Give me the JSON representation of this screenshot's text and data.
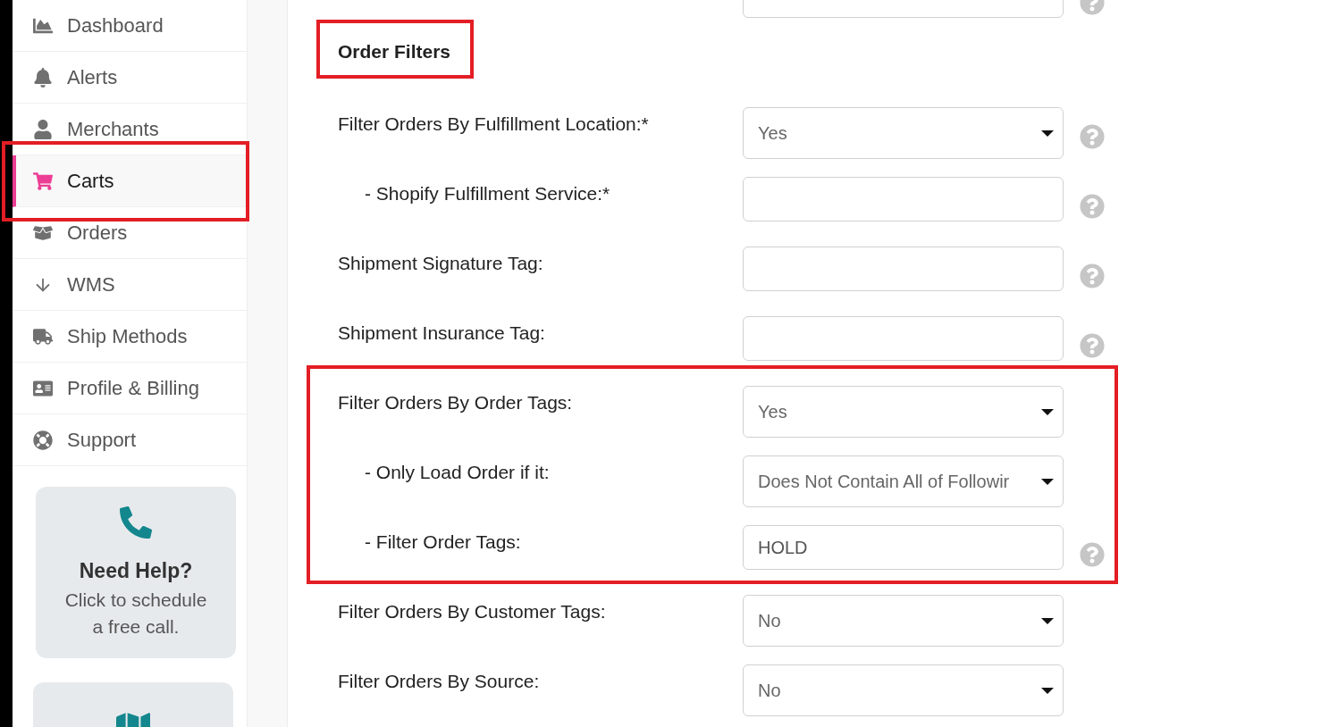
{
  "sidebar": {
    "items": [
      {
        "label": "Dashboard",
        "selected": false,
        "highlighted": false
      },
      {
        "label": "Alerts",
        "selected": false,
        "highlighted": false
      },
      {
        "label": "Merchants",
        "selected": false,
        "highlighted": false
      },
      {
        "label": "Carts",
        "selected": true,
        "highlighted": true
      },
      {
        "label": "Orders",
        "selected": false,
        "highlighted": false
      },
      {
        "label": "WMS",
        "selected": false,
        "highlighted": false
      },
      {
        "label": "Ship Methods",
        "selected": false,
        "highlighted": false
      },
      {
        "label": "Profile & Billing",
        "selected": false,
        "highlighted": false
      },
      {
        "label": "Support",
        "selected": false,
        "highlighted": false
      }
    ],
    "help_card": {
      "title": "Need Help?",
      "text": "Click to schedule a free call."
    }
  },
  "main": {
    "previous_field": {
      "kind": "text",
      "help": true
    },
    "section": {
      "title": "Order Filters",
      "highlighted": true,
      "fields": [
        {
          "label": "Filter Orders By Fulfillment Location:*",
          "kind": "select",
          "value": "Yes",
          "help": true,
          "highlighted": false,
          "children": [
            {
              "label": "- Shopify Fulfillment Service:*",
              "kind": "text",
              "help": true,
              "highlighted": false
            }
          ]
        },
        {
          "label": "Shipment Signature Tag:",
          "kind": "text",
          "help": true,
          "highlighted": false
        },
        {
          "label": "Shipment Insurance Tag:",
          "kind": "text",
          "help": true,
          "highlighted": false
        },
        {
          "label": "Filter Orders By Order Tags:",
          "kind": "select",
          "value": "Yes",
          "help": false,
          "highlighted": true,
          "children": [
            {
              "label": "- Only Load Order if it:",
              "kind": "select",
              "value": "Does Not Contain All of Followir",
              "help": false,
              "highlighted": false
            },
            {
              "label": "- Filter Order Tags:",
              "kind": "text",
              "value": "HOLD",
              "help": true,
              "highlighted": false
            }
          ]
        },
        {
          "label": "Filter Orders By Customer Tags:",
          "kind": "select",
          "value": "No",
          "help": false,
          "highlighted": false
        },
        {
          "label": "Filter Orders By Source:",
          "kind": "select",
          "value": "No",
          "help": false,
          "highlighted": false
        }
      ]
    }
  }
}
